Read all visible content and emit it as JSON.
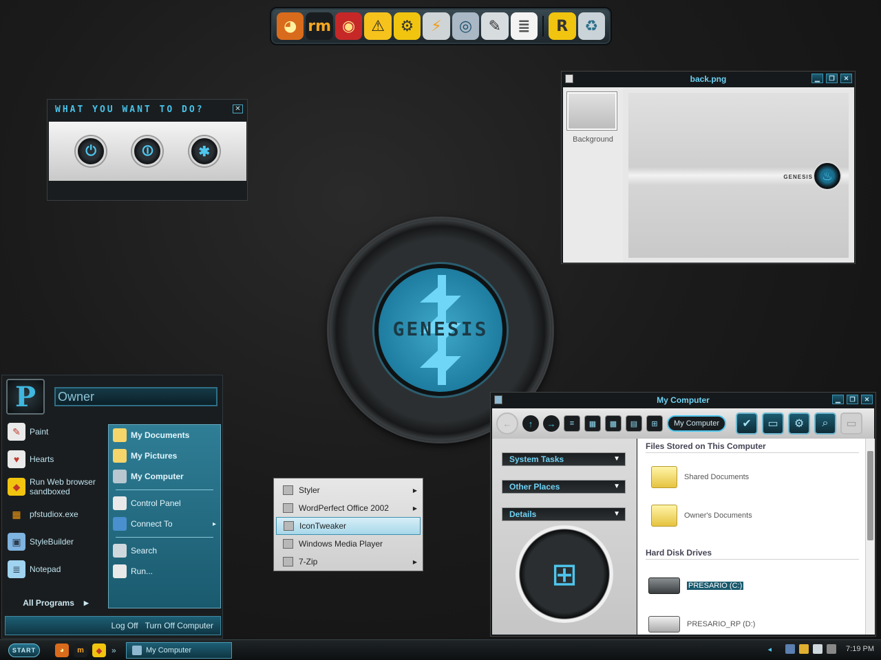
{
  "dock": {
    "icons": [
      {
        "name": "firefox-icon",
        "glyph": "◕",
        "bg": "#d96b1c",
        "fg": "#fff3a0"
      },
      {
        "name": "realmedia-icon",
        "glyph": "rm",
        "bg": "#1a1d1f",
        "fg": "#f5a623"
      },
      {
        "name": "burner-icon",
        "glyph": "◉",
        "bg": "#c62828",
        "fg": "#ffe082"
      },
      {
        "name": "road-sign-icon",
        "glyph": "⚠",
        "bg": "#f6c21c",
        "fg": "#222"
      },
      {
        "name": "tools-icon",
        "glyph": "⚙",
        "bg": "#f1c40f",
        "fg": "#333"
      },
      {
        "name": "winamp-bolt-icon",
        "glyph": "⚡",
        "bg": "#cfd4d6",
        "fg": "#f39c12"
      },
      {
        "name": "disc-drive-icon",
        "glyph": "◎",
        "bg": "#aab7c4",
        "fg": "#1a4f6e"
      },
      {
        "name": "pen-icon",
        "glyph": "✎",
        "bg": "#d7dcdf",
        "fg": "#333"
      },
      {
        "name": "notepad-icon",
        "glyph": "≣",
        "bg": "#f3f3f3",
        "fg": "#555"
      },
      {
        "name": "separator",
        "glyph": "",
        "bg": "",
        "fg": ""
      },
      {
        "name": "r-app-icon",
        "glyph": "R",
        "bg": "#f1c40f",
        "fg": "#333"
      },
      {
        "name": "recycle-bin-icon",
        "glyph": "♻",
        "bg": "#c9d3d8",
        "fg": "#2a6f8a"
      }
    ]
  },
  "power_dialog": {
    "title": "WHAT YOU WANT TO DO?",
    "close": "✕",
    "buttons": [
      {
        "name": "shutdown-button",
        "glyph": "⏻"
      },
      {
        "name": "restart-button",
        "glyph": "⏼"
      },
      {
        "name": "hibernate-button",
        "glyph": "✱"
      }
    ]
  },
  "viewer": {
    "title": "back.png",
    "thumb_label": "Background",
    "preview_brand": "GENESIS"
  },
  "center_logo": {
    "word": "GENESIS"
  },
  "start_menu": {
    "avatar_letter": "P",
    "user": "Owner",
    "pinned": [
      {
        "label": "Paint",
        "glyph": "✎",
        "bg": "#eaeaea",
        "fg": "#c0392b"
      },
      {
        "label": "Hearts",
        "glyph": "♥",
        "bg": "#eaeaea",
        "fg": "#c0392b"
      },
      {
        "label": "Run Web browser sandboxed",
        "glyph": "◆",
        "bg": "#f1c40f",
        "fg": "#c0392b"
      },
      {
        "label": "pfstudiox.exe",
        "glyph": "▦",
        "bg": "#1a1d1f",
        "fg": "#f39c12"
      },
      {
        "label": "StyleBuilder",
        "glyph": "▣",
        "bg": "#7fb3e0",
        "fg": "#2c3e50"
      },
      {
        "label": "Notepad",
        "glyph": "≣",
        "bg": "#9fd3f0",
        "fg": "#2c3e50"
      }
    ],
    "all_programs": "All Programs",
    "all_programs_arrow": "▶",
    "places": [
      {
        "label": "My Documents",
        "bold": true,
        "color": "#f6d56a"
      },
      {
        "label": "My Pictures",
        "bold": true,
        "color": "#f6d56a"
      },
      {
        "label": "My Computer",
        "bold": true,
        "color": "#b8c7d0"
      },
      {
        "label": "Control Panel",
        "bold": false,
        "color": "#e9e9e9"
      },
      {
        "label": "Connect To",
        "bold": false,
        "color": "#4a8fce"
      },
      {
        "label": "Search",
        "bold": false,
        "color": "#cfd8dc"
      },
      {
        "label": "Run...",
        "bold": false,
        "color": "#e9e9e9"
      }
    ],
    "connect_arrow": "▸",
    "log_off": "Log Off",
    "turn_off": "Turn Off Computer"
  },
  "submenu": {
    "items": [
      {
        "label": "Styler",
        "arrow": "▶"
      },
      {
        "label": "WordPerfect Office 2002",
        "arrow": "▶"
      },
      {
        "label": "IconTweaker",
        "arrow": ""
      },
      {
        "label": "Windows Media Player",
        "arrow": ""
      },
      {
        "label": "7-Zip",
        "arrow": "▶"
      }
    ],
    "active_index": 2
  },
  "my_computer": {
    "title": "My Computer",
    "address": "My Computer",
    "toolbar_round": [
      "←",
      "↑",
      "→"
    ],
    "toolbar_views": [
      "≡",
      "▦",
      "▩",
      "▤",
      "⊞"
    ],
    "toolbar_big": [
      "✔",
      "▭",
      "⚙",
      "⌕",
      "▭"
    ],
    "tasks": [
      "System Tasks",
      "Other Places",
      "Details"
    ],
    "task_chevron": "▼",
    "files_header": "Files Stored on This Computer",
    "folders": [
      "Shared Documents",
      "Owner's Documents"
    ],
    "drives_header": "Hard Disk Drives",
    "drives": [
      "PRESARIO (C:)",
      "PRESARIO_RP (D:)"
    ],
    "windows_glyph": "⊞"
  },
  "taskbar": {
    "start": "START",
    "quick_launch": [
      {
        "name": "firefox-quicklaunch-icon",
        "glyph": "◕",
        "bg": "#d96b1c",
        "fg": "#fff3a0"
      },
      {
        "name": "realmedia-quicklaunch-icon",
        "glyph": "m",
        "bg": "#1a1d1f",
        "fg": "#f5a623"
      },
      {
        "name": "sandbox-quicklaunch-icon",
        "glyph": "◆",
        "bg": "#f1c40f",
        "fg": "#c0392b"
      }
    ],
    "chevron": "»",
    "task": "My Computer",
    "tray_arrow": "◂",
    "time": "7:19 PM"
  }
}
